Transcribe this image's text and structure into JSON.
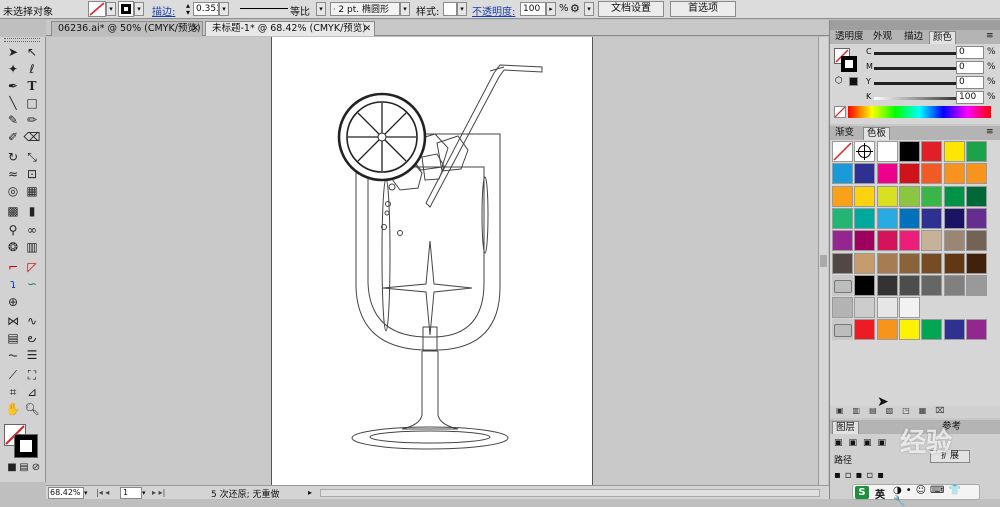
{
  "control_bar": {
    "selection_label": "未选择对象",
    "stroke_label": "描边:",
    "stroke_value": "0.353",
    "uniform_label": "等比",
    "brush_label": "2 pt. 椭圆形",
    "style_label": "样式:",
    "opacity_label": "不透明度:",
    "opacity_value": "100",
    "opacity_unit": "%",
    "doc_setup_button": "文档设置",
    "preferences_button": "首选项"
  },
  "document_tabs": [
    {
      "label": "06236.ai* @ 50% (CMYK/预览)",
      "close": "✕"
    },
    {
      "label": "未标题-1* @ 68.42% (CMYK/预览)",
      "close": "✕"
    }
  ],
  "color_panel": {
    "tabs": [
      "透明度",
      "外观",
      "描边",
      "颜色"
    ],
    "channels": [
      {
        "label": "C",
        "value": "0",
        "unit": "%"
      },
      {
        "label": "M",
        "value": "0",
        "unit": "%"
      },
      {
        "label": "Y",
        "value": "0",
        "unit": "%"
      },
      {
        "label": "K",
        "value": "100",
        "unit": "%"
      }
    ]
  },
  "swatches_panel": {
    "tabs": [
      "渐变",
      "色板"
    ]
  },
  "bottom_panel": {
    "tabs": [
      "图层",
      "参考"
    ],
    "path_label": "路径",
    "expand_button": "扩展"
  },
  "status_bar": {
    "zoom": "68.42%",
    "page": "1",
    "undo_status": "5 次还原; 无重做"
  },
  "ime": {
    "language": "英"
  },
  "watermark": "经验",
  "colors": {
    "ui_bg": "#c8c8c8",
    "artboard": "#ffffff",
    "accent_red": "#e01f26",
    "link_blue": "#1a3fb0"
  }
}
